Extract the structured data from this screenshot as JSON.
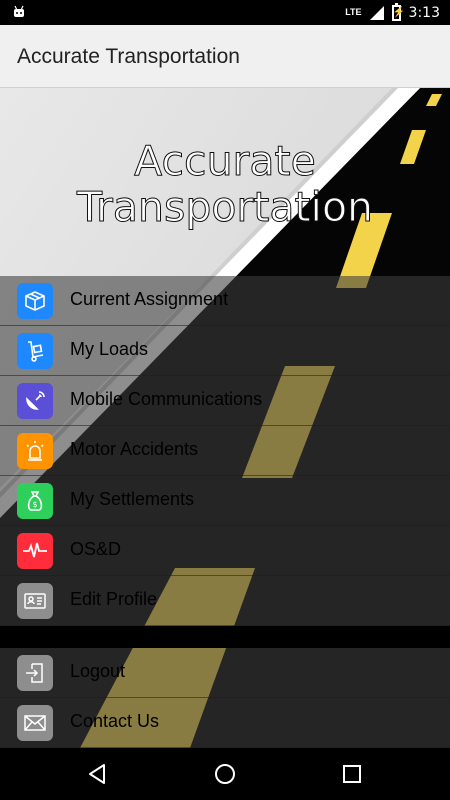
{
  "status_bar": {
    "network": "LTE",
    "time": "3:13"
  },
  "app_bar": {
    "title": "Accurate Transportation"
  },
  "header": {
    "line1": "Accurate",
    "line2": "Transportation"
  },
  "menu": {
    "items": [
      {
        "label": "Current Assignment",
        "icon": "box-icon",
        "color": "#1e88ff"
      },
      {
        "label": "My Loads",
        "icon": "hand-truck-icon",
        "color": "#1e88ff"
      },
      {
        "label": "Mobile Communications",
        "icon": "satellite-dish-icon",
        "color": "#5a4fd6"
      },
      {
        "label": "Motor Accidents",
        "icon": "siren-icon",
        "color": "#ff9300"
      },
      {
        "label": "My Settlements",
        "icon": "money-bag-icon",
        "color": "#2fcf5b"
      },
      {
        "label": "OS&D",
        "icon": "heartbeat-icon",
        "color": "#ff2d3b"
      },
      {
        "label": "Edit Profile",
        "icon": "id-card-icon",
        "color": "#8e8e8e"
      }
    ],
    "footer_items": [
      {
        "label": "Logout",
        "icon": "logout-icon",
        "color": "#8e8e8e"
      },
      {
        "label": "Contact Us",
        "icon": "envelope-icon",
        "color": "#8e8e8e"
      }
    ]
  },
  "nav_bar": {
    "back": "back-icon",
    "home": "home-icon",
    "recents": "recents-icon"
  }
}
